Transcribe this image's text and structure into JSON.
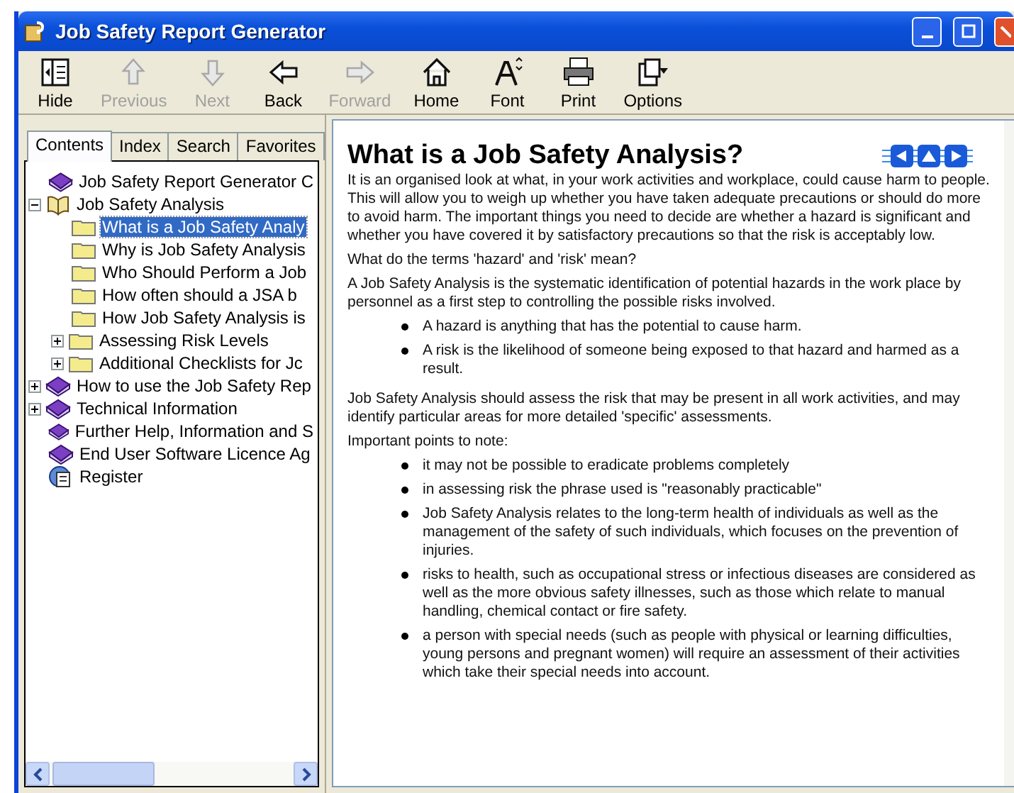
{
  "window": {
    "title": "Job Safety Report Generator"
  },
  "toolbar": [
    {
      "label": "Hide",
      "kind": "hide",
      "disabled": false
    },
    {
      "label": "Previous",
      "kind": "up",
      "disabled": true
    },
    {
      "label": "Next",
      "kind": "down",
      "disabled": true
    },
    {
      "label": "Back",
      "kind": "back",
      "disabled": false
    },
    {
      "label": "Forward",
      "kind": "forward",
      "disabled": true
    },
    {
      "label": "Home",
      "kind": "home",
      "disabled": false
    },
    {
      "label": "Font",
      "kind": "font",
      "disabled": false
    },
    {
      "label": "Print",
      "kind": "print",
      "disabled": false
    },
    {
      "label": "Options",
      "kind": "options",
      "disabled": false
    }
  ],
  "tabs": [
    {
      "label": "Contents",
      "selected": true
    },
    {
      "label": "Index",
      "selected": false
    },
    {
      "label": "Search",
      "selected": false
    },
    {
      "label": "Favorites",
      "selected": false
    }
  ],
  "tree": [
    {
      "label": "Job Safety Report Generator C",
      "kind": "book",
      "selected": false
    },
    {
      "label": "Job Safety Analysis",
      "kind": "book-open",
      "selected": false,
      "expanded": true,
      "children": [
        {
          "label": "What is a Job Safety Analy",
          "kind": "folder",
          "selected": true
        },
        {
          "label": "Why is Job Safety Analysis",
          "kind": "folder",
          "selected": false
        },
        {
          "label": "Who Should Perform a Job",
          "kind": "folder",
          "selected": false
        },
        {
          "label": "How often should a JSA b",
          "kind": "folder",
          "selected": false
        },
        {
          "label": "How Job Safety Analysis is",
          "kind": "folder",
          "selected": false
        },
        {
          "label": "Assessing Risk Levels",
          "kind": "folder",
          "selected": false,
          "expanded": false
        },
        {
          "label": "Additional Checklists for Jc",
          "kind": "folder",
          "selected": false,
          "expanded": false
        }
      ]
    },
    {
      "label": "How to use the Job Safety Rep",
      "kind": "book",
      "selected": false,
      "expanded": false
    },
    {
      "label": "Technical Information",
      "kind": "book",
      "selected": false,
      "expanded": false
    },
    {
      "label": "Further Help, Information and S",
      "kind": "book",
      "selected": false
    },
    {
      "label": "End User Software Licence Ag",
      "kind": "book",
      "selected": false
    },
    {
      "label": "Register",
      "kind": "register",
      "selected": false
    }
  ],
  "article": {
    "heading": "What is a Job Safety Analysis?",
    "blocks": [
      {
        "kind": "para",
        "text": "It is an organised look at what, in your work activities and workplace, could cause harm to people. This will allow you to weigh up whether you have taken adequate precautions or should do more to avoid harm. The important things you need to decide are whether a hazard is significant and whether you have covered it by satisfactory precautions so that the risk is acceptably low."
      },
      {
        "kind": "para",
        "text": "What do the terms 'hazard' and 'risk' mean?"
      },
      {
        "kind": "para",
        "text": "A Job Safety Analysis is the systematic identification of potential hazards in the work place by personnel as a first step to controlling the possible risks involved."
      },
      {
        "kind": "bullets",
        "items": [
          "A hazard is anything that has the potential to cause harm.",
          "A risk is the likelihood of someone being exposed to that hazard and harmed as a result."
        ]
      },
      {
        "kind": "para",
        "text": "Job Safety Analysis should assess the risk that may be present in all work activities, and may identify particular areas for more detailed 'specific' assessments."
      },
      {
        "kind": "para",
        "text": "Important points to note:"
      },
      {
        "kind": "bullets",
        "items": [
          "it may not be possible to eradicate problems completely",
          "in assessing risk the phrase used is \"reasonably practicable\"",
          "Job Safety Analysis relates to the long-term health of individuals as well as the management of the safety of such individuals, which focuses on the prevention of injuries.",
          "risks to health, such as occupational stress or infectious diseases are considered as well as the more obvious safety illnesses, such as those which relate to manual handling, chemical contact or fire safety.",
          "a person with special needs (such as people with physical or learning difficulties, young persons and pregnant women) will require an assessment of their activities which take their special needs into account."
        ]
      }
    ]
  }
}
